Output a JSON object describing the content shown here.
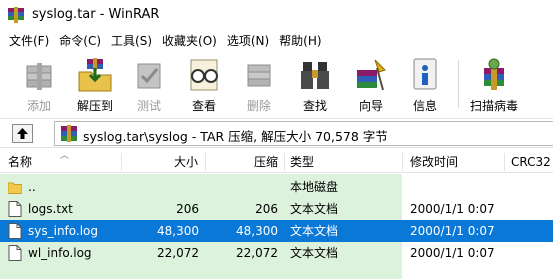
{
  "window": {
    "title": "syslog.tar - WinRAR"
  },
  "menu": [
    "文件(F)",
    "命令(C)",
    "工具(S)",
    "收藏夹(O)",
    "选项(N)",
    "帮助(H)"
  ],
  "toolbar": [
    {
      "label": "添加",
      "icon": "books-add-icon",
      "enabled": false
    },
    {
      "label": "解压到",
      "icon": "extract-folder-icon",
      "enabled": true
    },
    {
      "label": "测试",
      "icon": "test-check-icon",
      "enabled": false
    },
    {
      "label": "查看",
      "icon": "glasses-view-icon",
      "enabled": true
    },
    {
      "label": "删除",
      "icon": "delete-books-icon",
      "enabled": false
    },
    {
      "label": "查找",
      "icon": "binoculars-find-icon",
      "enabled": true
    },
    {
      "label": "向导",
      "icon": "wizard-icon",
      "enabled": true
    },
    {
      "label": "信息",
      "icon": "info-icon",
      "enabled": true
    },
    {
      "label": "扫描病毒",
      "icon": "virus-scan-icon",
      "enabled": true
    }
  ],
  "address": {
    "text": "syslog.tar\\syslog - TAR 压缩, 解压大小 70,578 字节"
  },
  "columns": {
    "name": "名称",
    "size": "大小",
    "packed": "压缩",
    "type": "类型",
    "modified": "修改时间",
    "crc": "CRC32"
  },
  "files": [
    {
      "name": "..",
      "size": "",
      "packed": "",
      "type": "本地磁盘",
      "modified": "",
      "icon": "folder-icon",
      "selected": false
    },
    {
      "name": "logs.txt",
      "size": "206",
      "packed": "206",
      "type": "文本文档",
      "modified": "2000/1/1 0:07",
      "icon": "text-file-icon",
      "selected": false
    },
    {
      "name": "sys_info.log",
      "size": "48,300",
      "packed": "48,300",
      "type": "文本文档",
      "modified": "2000/1/1 0:07",
      "icon": "text-file-icon",
      "selected": true
    },
    {
      "name": "wl_info.log",
      "size": "22,072",
      "packed": "22,072",
      "type": "文本文档",
      "modified": "2000/1/1 0:07",
      "icon": "text-file-icon",
      "selected": false
    }
  ],
  "colors": {
    "selection": "#0a78d7",
    "list_highlight": "#ddf2dc",
    "disabled_text": "#9a9a9a"
  }
}
